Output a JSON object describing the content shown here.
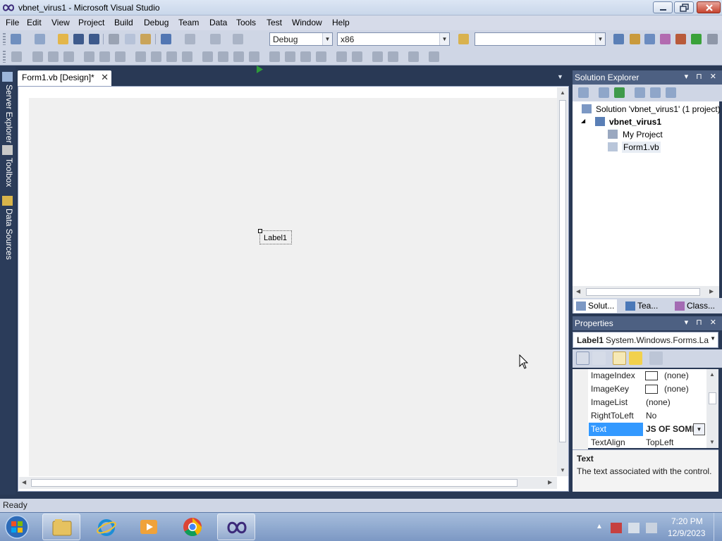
{
  "window": {
    "title": "vbnet_virus1 - Microsoft Visual Studio"
  },
  "menu": [
    "File",
    "Edit",
    "View",
    "Project",
    "Build",
    "Debug",
    "Team",
    "Data",
    "Tools",
    "Test",
    "Window",
    "Help"
  ],
  "toolbar": {
    "config_value": "Debug",
    "platform_value": "x86",
    "find_value": ""
  },
  "side_tabs": [
    "Server Explorer",
    "Toolbox",
    "Data Sources"
  ],
  "document": {
    "tab_label": "Form1.vb [Design]*",
    "tab_close": "✕",
    "label_control_text": "Label1"
  },
  "solution_explorer": {
    "title": "Solution Explorer",
    "controls": "▾ ⊓ ✕",
    "solution": "Solution 'vbnet_virus1' (1 project)",
    "project": "vbnet_virus1",
    "items": [
      "My Project",
      "Form1.vb"
    ],
    "tabs": [
      "Solut...",
      "Tea...",
      "Class..."
    ]
  },
  "properties": {
    "title": "Properties",
    "controls": "▾ ⊓ ✕",
    "object_name": "Label1",
    "object_type": "System.Windows.Forms.La",
    "rows": [
      {
        "name": "ImageIndex",
        "value": "(none)"
      },
      {
        "name": "ImageKey",
        "value": "(none)"
      },
      {
        "name": "ImageList",
        "value": "(none)"
      },
      {
        "name": "RightToLeft",
        "value": "No"
      },
      {
        "name": "Text",
        "value": "JS OF SOME"
      },
      {
        "name": "TextAlign",
        "value": "TopLeft"
      }
    ],
    "description_title": "Text",
    "description_text": "The text associated with the control."
  },
  "status": {
    "text": "Ready"
  },
  "taskbar": {
    "time": "7:20 PM",
    "date": "12/9/2023"
  },
  "colors": {
    "ide_background": "#293955",
    "panel_header": "#4d6082",
    "toolbar": "#cfd6e5",
    "selected_property": "#3399ff"
  }
}
